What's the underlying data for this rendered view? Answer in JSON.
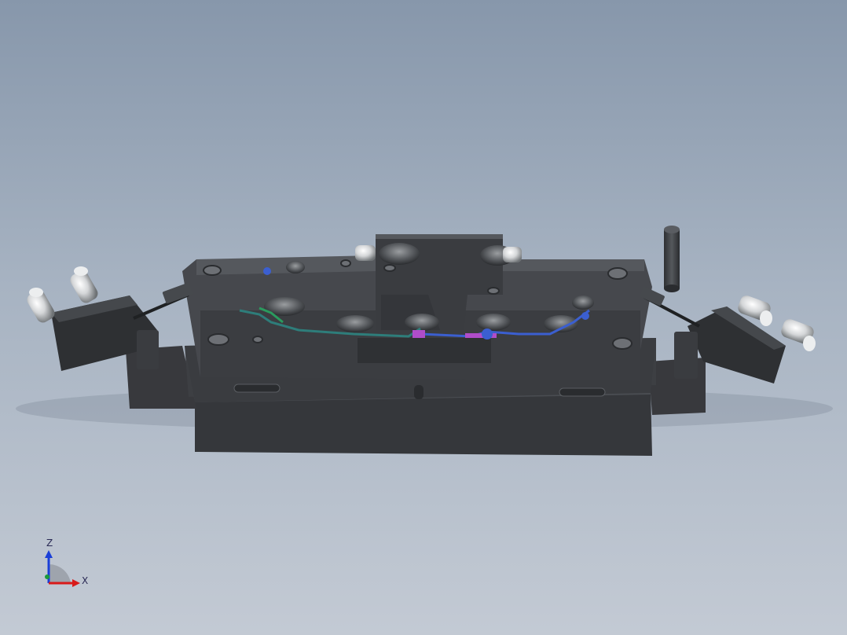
{
  "viewport": {
    "background_top": "#8797ab",
    "background_bottom": "#c3cad4"
  },
  "model": {
    "part_color": "#3c3e42",
    "part_highlight": "#52555a",
    "accent_colors": [
      "#2e7d7a",
      "#3b5fd0",
      "#b04dc9",
      "#2a9b5e"
    ],
    "fitting_color": "#d6d8da"
  },
  "triad": {
    "z_label": "Z",
    "x_label": "X",
    "z_color": "#1a3fd8",
    "x_color": "#d81a1a",
    "y_color": "#1a9b3a"
  }
}
